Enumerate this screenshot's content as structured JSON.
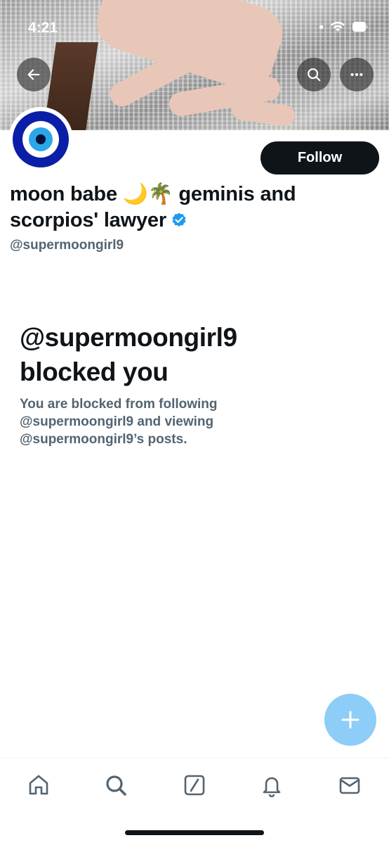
{
  "status_bar": {
    "time": "4:21"
  },
  "profile": {
    "display_name_line1": "moon babe 🌙🌴 geminis and",
    "display_name_line2": "scorpios' lawyer",
    "handle": "@supermoongirl9",
    "follow_label": "Follow"
  },
  "blocked": {
    "title_line1": "@supermoongirl9",
    "title_line2": "blocked you",
    "desc_line1": "You are blocked from following",
    "desc_line2": "@supermoongirl9 and viewing",
    "desc_line3": "@supermoongirl9’s posts."
  },
  "tabs": [
    {
      "icon": "home-icon"
    },
    {
      "icon": "search-icon"
    },
    {
      "icon": "grok-icon"
    },
    {
      "icon": "bell-icon"
    },
    {
      "icon": "mail-icon"
    }
  ],
  "colors": {
    "accent": "#1d9bf0",
    "fab": "#8ecdf7",
    "text_primary": "#0f1419",
    "text_secondary": "#536471"
  }
}
